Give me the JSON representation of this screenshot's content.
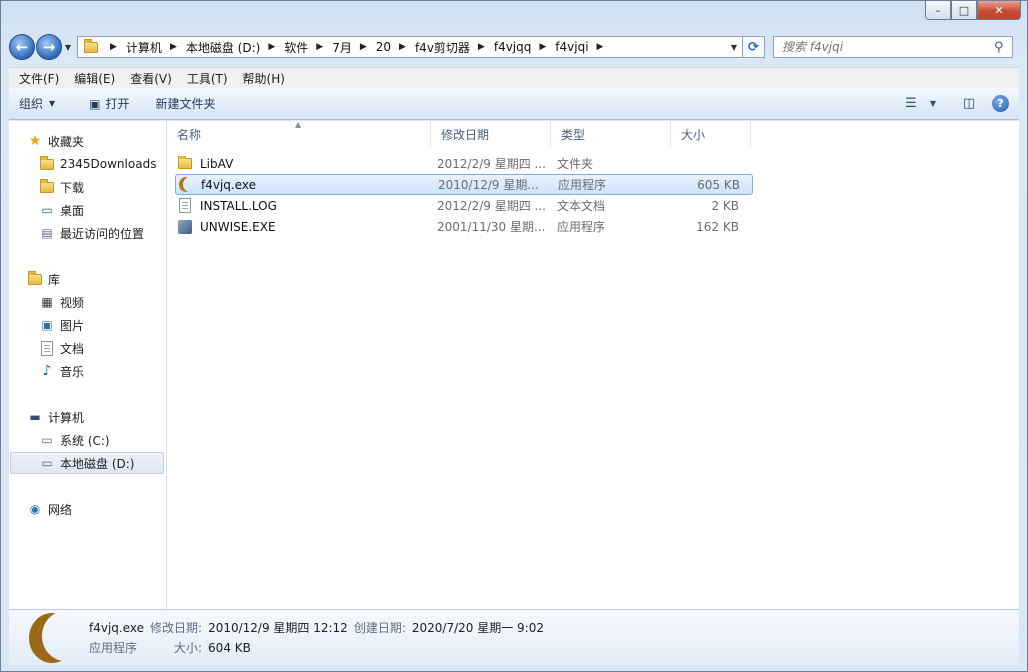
{
  "window": {
    "caption_buttons": {
      "min": "–",
      "max": "□",
      "close": "✕"
    }
  },
  "address_bar": {
    "crumbs": [
      "计算机",
      "本地磁盘 (D:)",
      "软件",
      "7月",
      "20",
      "f4v剪切器",
      "f4vjqq",
      "f4vjqi"
    ],
    "search_placeholder": "搜索 f4vjqi"
  },
  "menu": [
    "文件(F)",
    "编辑(E)",
    "查看(V)",
    "工具(T)",
    "帮助(H)"
  ],
  "commands": {
    "organize": "组织",
    "open": "打开",
    "new_folder": "新建文件夹"
  },
  "nav": {
    "favorites": {
      "label": "收藏夹",
      "items": [
        "2345Downloads",
        "下载",
        "桌面",
        "最近访问的位置"
      ]
    },
    "libraries": {
      "label": "库",
      "items": [
        "视频",
        "图片",
        "文档",
        "音乐"
      ]
    },
    "computer": {
      "label": "计算机",
      "items": [
        "系统 (C:)",
        "本地磁盘 (D:)"
      ]
    },
    "network": {
      "label": "网络"
    }
  },
  "columns": {
    "name": "名称",
    "date": "修改日期",
    "type": "类型",
    "size": "大小"
  },
  "files": [
    {
      "name": "LibAV",
      "date": "2012/2/9 星期四 ...",
      "type": "文件夹",
      "size": "",
      "icon": "folder-icon"
    },
    {
      "name": "f4vjq.exe",
      "date": "2010/12/9 星期...",
      "type": "应用程序",
      "size": "605 KB",
      "icon": "app-moon-icon"
    },
    {
      "name": "INSTALL.LOG",
      "date": "2012/2/9 星期四 ...",
      "type": "文本文档",
      "size": "2 KB",
      "icon": "text-doc-icon"
    },
    {
      "name": "UNWISE.EXE",
      "date": "2001/11/30 星期...",
      "type": "应用程序",
      "size": "162 KB",
      "icon": "setup-icon"
    }
  ],
  "details": {
    "filename": "f4vjq.exe",
    "modified_label": "修改日期:",
    "modified_value": "2010/12/9 星期四 12:12",
    "created_label": "创建日期:",
    "created_value": "2020/7/20 星期一 9:02",
    "type_value": "应用程序",
    "size_label": "大小:",
    "size_value": "604 KB"
  },
  "colors": {
    "selection_border": "#84acdd",
    "selection_fill": "#cde3fb",
    "nav_accent": "#2c69b8"
  }
}
